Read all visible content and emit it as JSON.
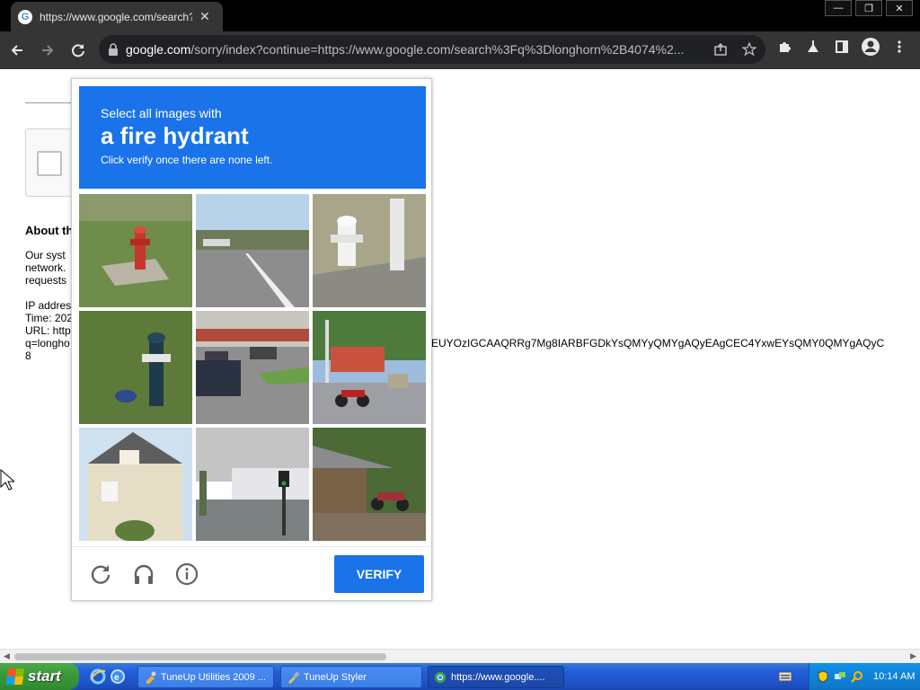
{
  "browser": {
    "tab": {
      "favicon": "google-g-icon",
      "title": "https://www.google.com/search?q=",
      "close": "✕"
    },
    "window_controls": [
      "minimize-icon",
      "restore-icon",
      "close-icon"
    ],
    "omnibox": {
      "url_host": "google.com",
      "url_rest": "/sorry/index?continue=https://www.google.com/search%3Fq%3Dlonghorn%2B4074%2..."
    }
  },
  "page": {
    "about_title": "About th",
    "about_lines": [
      "Our syst",
      "network.",
      "requests"
    ],
    "ip_lines": [
      "IP addres",
      "Time: 202",
      "URL: http",
      "q=longho",
      "8"
    ],
    "long_query": "EUYOzIGCAAQRRg7Mg8IARBFGDkYsQMYyQMYgAQyEAgCEC4YxwEYsQMY0QMYgAQyC"
  },
  "challenge": {
    "instruction_small": "Select all images with",
    "instruction_big": "a fire hydrant",
    "instruction_sub": "Click verify once there are none left.",
    "tiles": [
      "red-fire-hydrant-grass",
      "road-highway",
      "white-fire-hydrant",
      "dark-fire-hydrant-grass",
      "parking-lot-cars",
      "street-motorcycle",
      "house",
      "traffic-light-street",
      "shack-motorcycles"
    ],
    "footer_icons": [
      "reload-icon",
      "headphones-icon",
      "info-icon"
    ],
    "verify_label": "VERIFY",
    "accent": "#1a73e8"
  },
  "taskbar": {
    "start_label": "start",
    "buttons": [
      "TuneUp Utilities 2009 ...",
      "TuneUp Styler",
      "https://www.google...."
    ],
    "clock": "10:14 AM"
  }
}
